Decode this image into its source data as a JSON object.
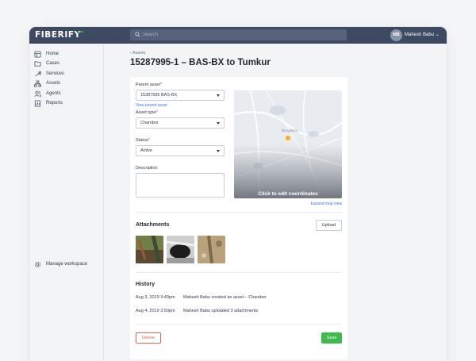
{
  "app": {
    "logo": "FIBERIFY",
    "search_placeholder": "Search",
    "user_initials": "MB",
    "user_name": "Mahesh Babu",
    "user_caret": "⌄",
    "brand_color": "#3d4a61",
    "accent_color": "#3fba4e"
  },
  "sidebar": {
    "items": [
      {
        "label": "Home",
        "icon": "home-icon"
      },
      {
        "label": "Cases",
        "icon": "folder-icon"
      },
      {
        "label": "Services",
        "icon": "wrench-icon"
      },
      {
        "label": "Assets",
        "icon": "hierarchy-icon"
      },
      {
        "label": "Agents",
        "icon": "people-icon"
      },
      {
        "label": "Reports",
        "icon": "report-icon"
      }
    ],
    "manage_workspace": "Manage workspace"
  },
  "page": {
    "breadcrumb": "‹ Assets",
    "title": "15287995-1 – BAS-BX to Tumkur"
  },
  "form": {
    "parent_asset": {
      "label": "Parent asset",
      "required": "*",
      "value": "15287995 BAS-BX",
      "link": "View parent asset"
    },
    "asset_type": {
      "label": "Asset type",
      "required": "*",
      "value": "Chambor"
    },
    "status": {
      "label": "Status",
      "required": "*",
      "value": "Active"
    },
    "description": {
      "label": "Description",
      "value": ""
    },
    "map": {
      "caption": "Click to edit coordinates",
      "expand_link": "Expand map view",
      "place_label": "Bengaluru"
    }
  },
  "attachments": {
    "heading": "Attachments",
    "upload_label": "Upload",
    "items": [
      "attachment-photo-1",
      "attachment-photo-2",
      "attachment-photo-3"
    ]
  },
  "history": {
    "heading": "History",
    "rows": [
      {
        "date": "Aug 3, 2019 3:40pm",
        "text": "Mahesh Babu created an asset – Chamber"
      },
      {
        "date": "Aug 4, 2019 3:50pm",
        "text": "Mahesh Babu uploaded 3 attachments"
      }
    ]
  },
  "actions": {
    "delete_label": "Delete",
    "save_label": "Save",
    "delete_color": "#e0674f",
    "save_color": "#3fba4e"
  }
}
